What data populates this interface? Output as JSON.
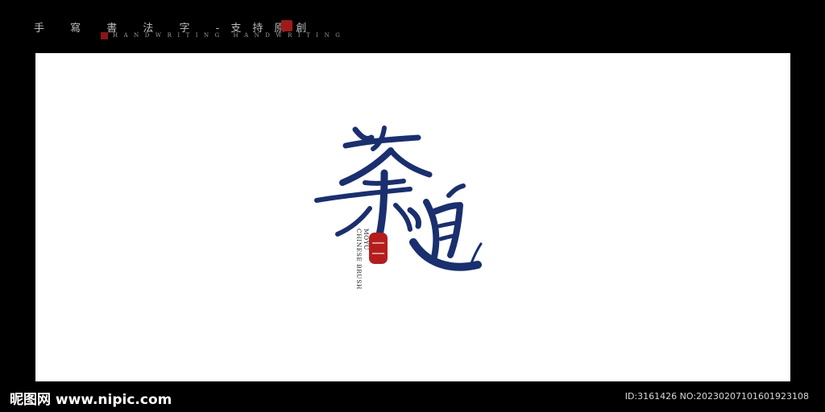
{
  "header": {
    "title": "手 寫 書 法 字 -支持原創",
    "subtitle": "HANDWRITING HANDWRITING"
  },
  "artwork": {
    "calligraphy_text": "茶道",
    "side_text_line1": "MOYU",
    "side_text_line2": "CHINESE BRUSH",
    "ink_color": "#1a2f6e",
    "seal_color": "#b51d1d"
  },
  "footer": {
    "logo_text": "昵图网 www.nipic.com",
    "id_text": "ID:3161426 NO:20230207101601923108"
  }
}
